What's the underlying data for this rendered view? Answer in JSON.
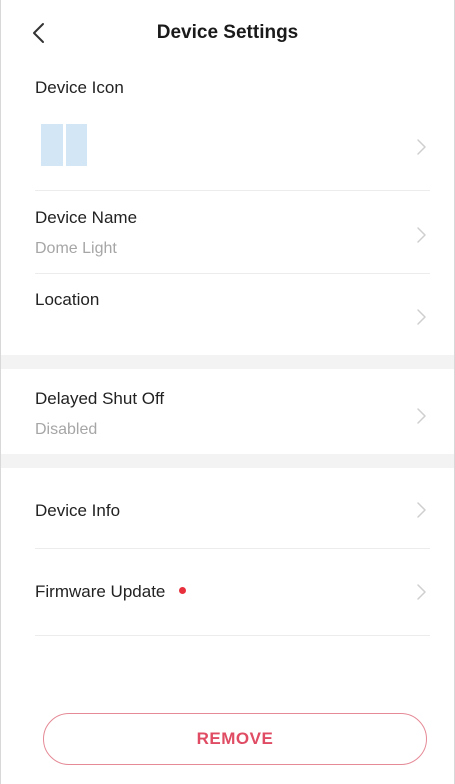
{
  "header": {
    "title": "Device Settings",
    "back_icon": "chevron-left-icon"
  },
  "rows": {
    "device_icon": {
      "label": "Device Icon",
      "icon_color": "#d3e6f5"
    },
    "device_name": {
      "label": "Device Name",
      "value": "Dome Light"
    },
    "location": {
      "label": "Location",
      "value": ""
    },
    "delayed_shut_off": {
      "label": "Delayed Shut Off",
      "value": "Disabled"
    },
    "device_info": {
      "label": "Device Info"
    },
    "firmware_update": {
      "label": "Firmware Update",
      "badge_color": "#e8303d"
    }
  },
  "remove_button": {
    "label": "REMOVE",
    "color": "#df4c63"
  }
}
